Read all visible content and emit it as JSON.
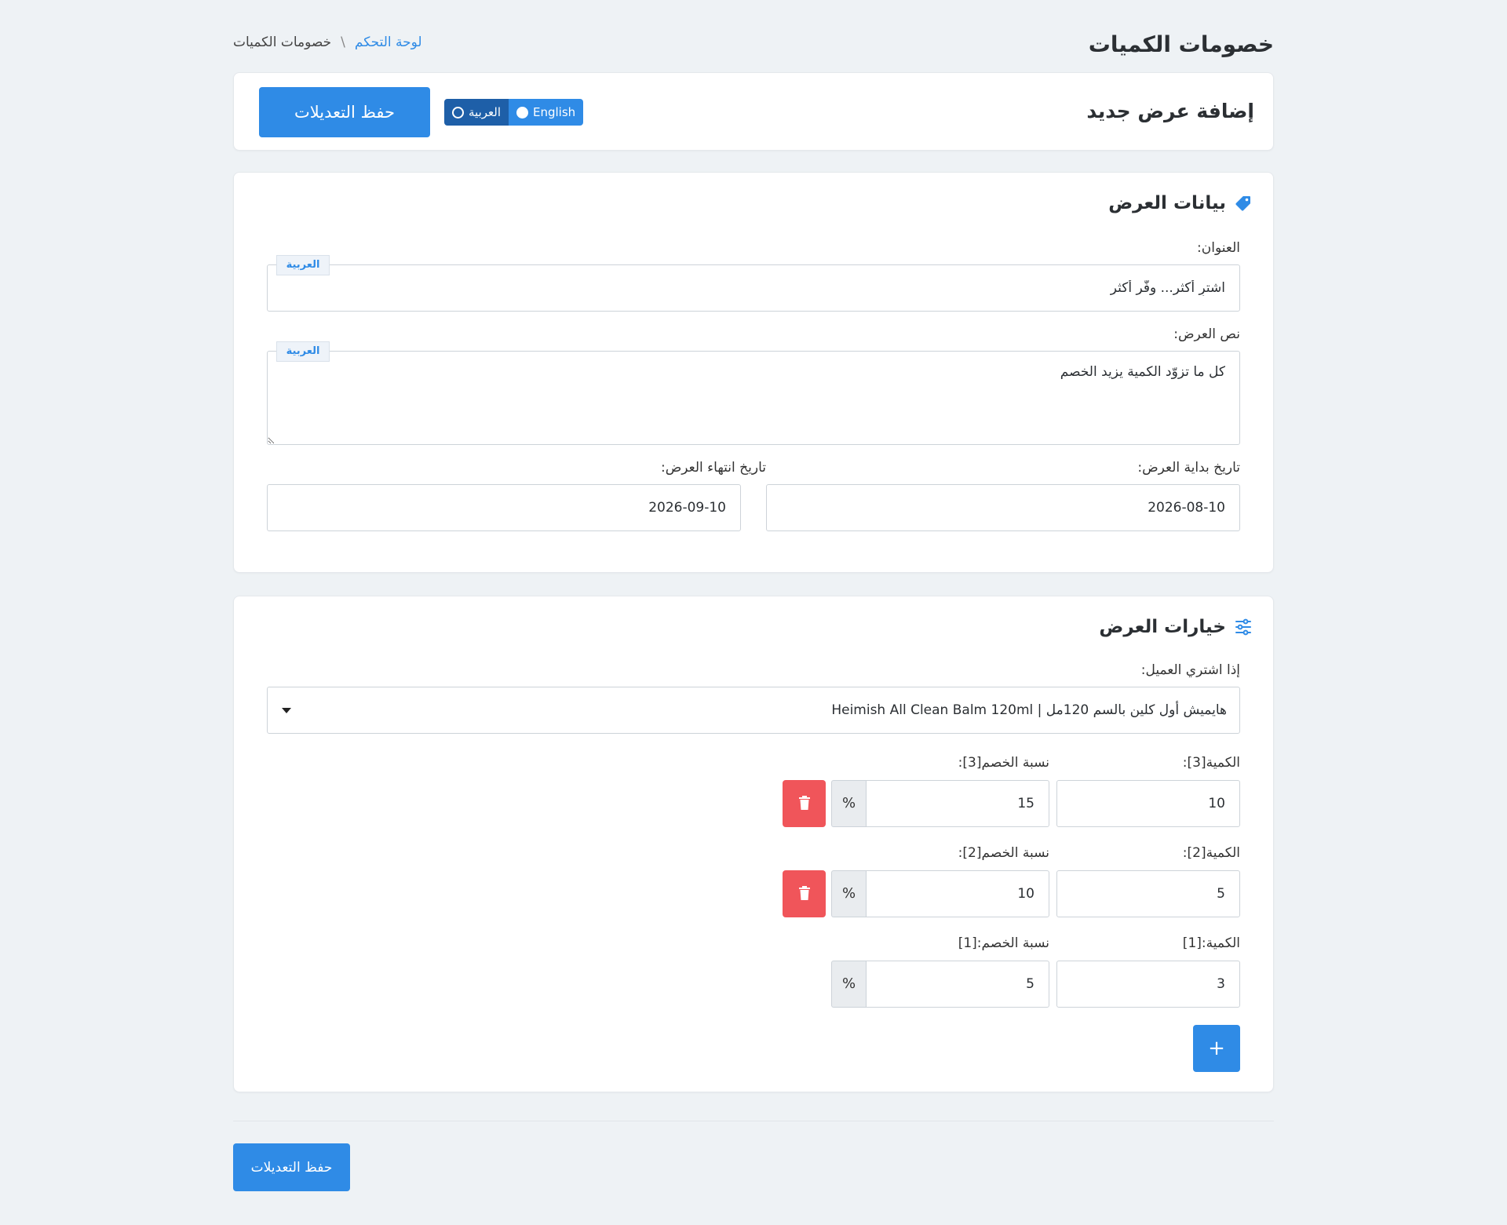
{
  "header": {
    "title": "خصومات الكميات",
    "breadcrumb_home": "لوحة التحكم",
    "breadcrumb_sep": "\\",
    "breadcrumb_current": "خصومات الكميات"
  },
  "topbar": {
    "title": "إضافة عرض جديد",
    "lang_en": "English",
    "lang_ar": "العربية",
    "save_label": "حفظ التعديلات"
  },
  "info": {
    "section_title": "بيانات العرض",
    "title_label": "العنوان:",
    "title_lang": "العربية",
    "title_value": "اشترِ أكثر... وفّر أكثر",
    "text_label": "نص العرض:",
    "text_lang": "العربية",
    "text_value": "كل ما تزوّد الكمية يزيد الخصم",
    "start_label": "تاريخ بداية العرض:",
    "start_value": "2026-08-10",
    "end_label": "تاريخ انتهاء العرض:",
    "end_value": "2026-09-10"
  },
  "options": {
    "section_title": "خيارات العرض",
    "product_label": "إذا اشتري العميل:",
    "product_value": "هايميش أول كلين بالسم 120مل | Heimish All Clean Balm 120ml",
    "tiers": [
      {
        "qty_label": "الكمية[3]:",
        "qty": "10",
        "disc_label": "نسبة الخصم[3]:",
        "disc": "15"
      },
      {
        "qty_label": "الكمية[2]:",
        "qty": "5",
        "disc_label": "نسبة الخصم[2]:",
        "disc": "10"
      },
      {
        "qty_label": "الكمية:[1]",
        "qty": "3",
        "disc_label": "نسبة الخصم:[1]",
        "disc": "5"
      }
    ],
    "percent_symbol": "%",
    "add_symbol": "+"
  },
  "footer": {
    "save_label": "حفظ التعديلات"
  },
  "colors": {
    "primary": "#2f8be6",
    "danger": "#f0555a",
    "background": "#eef2f5"
  }
}
